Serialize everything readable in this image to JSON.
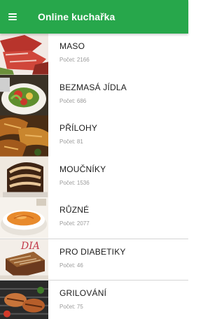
{
  "app": {
    "title": "Online kuchařka",
    "accent_color": "#27a74b",
    "menu_icon": "hamburger-menu-icon"
  },
  "categories": [
    {
      "name": "MASO",
      "count": "Počet: 2166"
    },
    {
      "name": "BEZMASÁ JÍDLA",
      "count": "Počet: 686"
    },
    {
      "name": "PŘÍLOHY",
      "count": "Počet: 81"
    },
    {
      "name": "MOUČNÍKY",
      "count": "Počet: 1536"
    },
    {
      "name": "RŮZNÉ",
      "count": "Počet: 2077"
    },
    {
      "name": "PRO DIABETIKY",
      "count": "Počet: 46"
    },
    {
      "name": "GRILOVÁNÍ",
      "count": "Počet: 75"
    }
  ]
}
